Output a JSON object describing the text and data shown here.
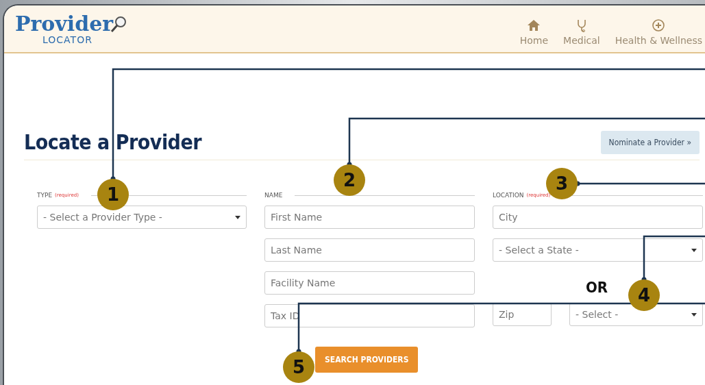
{
  "header": {
    "logo": {
      "title": "Provider",
      "subtitle": "LOCATOR"
    },
    "nav": [
      {
        "label": "Home"
      },
      {
        "label": "Medical"
      },
      {
        "label": "Health & Wellness"
      }
    ]
  },
  "page": {
    "title": "Locate a Provider",
    "nominate_button": "Nominate a Provider »"
  },
  "form": {
    "sections": [
      {
        "label": "TYPE",
        "required": "(required)",
        "fields": [
          {
            "kind": "select",
            "placeholder": "- Select a Provider Type -"
          }
        ]
      },
      {
        "label": "NAME",
        "fields": [
          {
            "kind": "input",
            "placeholder": "First Name"
          },
          {
            "kind": "input",
            "placeholder": "Last Name"
          },
          {
            "kind": "input",
            "placeholder": "Facility Name"
          },
          {
            "kind": "input",
            "placeholder": "Tax ID"
          }
        ]
      },
      {
        "label": "LOCATION",
        "required": "(required)",
        "fields": [
          {
            "kind": "input",
            "placeholder": "City"
          },
          {
            "kind": "select",
            "placeholder": "- Select a State -"
          }
        ],
        "or_label": "OR",
        "zip": {
          "placeholder": "Zip"
        },
        "radius": {
          "placeholder": "- Select -"
        }
      }
    ],
    "search_button": "SEARCH PROVIDERS"
  },
  "callouts": [
    "1",
    "2",
    "3",
    "4",
    "5"
  ]
}
